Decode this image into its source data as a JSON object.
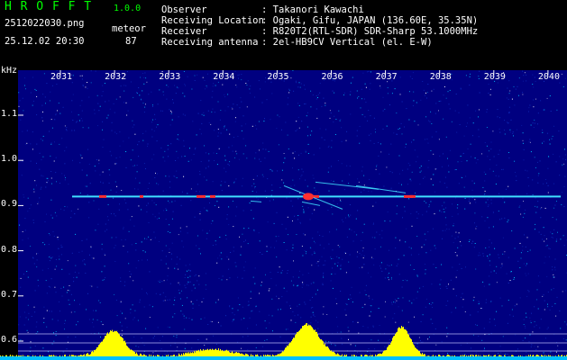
{
  "app": {
    "logo": "H R O F F T",
    "version": "1.0.0",
    "filename": "2512022030.png",
    "datetime": "25.12.02 20:30",
    "meteor_label": "meteor",
    "meteor_count": "87"
  },
  "info": [
    {
      "label": "Observer",
      "value": ": Takanori Kawachi"
    },
    {
      "label": "Receiving Location",
      "value": ": Ogaki, Gifu, JAPAN (136.60E, 35.35N)"
    },
    {
      "label": "Receiver",
      "value": ": R820T2(RTL-SDR) SDR-Sharp 53.1000MHz"
    },
    {
      "label": "Receiving antenna",
      "value": ": 2el-HB9CV Vertical (el. E-W)"
    }
  ],
  "spectrogram": {
    "y_unit": "kHz",
    "y_ticks": [
      "1.1",
      "1.0",
      "0.9",
      "0.8",
      "0.7",
      "0.6"
    ],
    "y_values": [
      1.1,
      1.0,
      0.9,
      0.8,
      0.7,
      0.6
    ],
    "x_ticks": [
      "2031",
      "2032",
      "2033",
      "2034",
      "2035",
      "2036",
      "2037",
      "2038",
      "2039",
      "2040"
    ],
    "carrier_khz": 0.92,
    "colors": {
      "background": "#000080",
      "carrier": "#40e0ff",
      "echo": "#ff3030",
      "level": "#ffff00",
      "noise": "#00c0ff"
    }
  }
}
